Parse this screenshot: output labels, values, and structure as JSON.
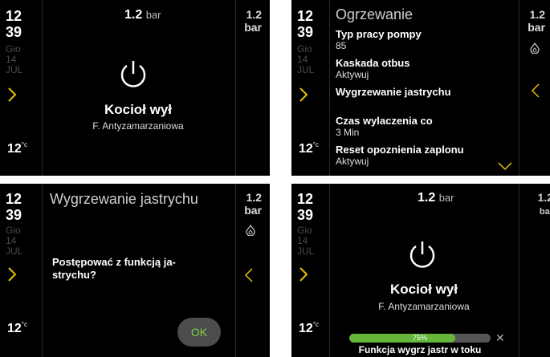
{
  "common": {
    "time_hour": "12",
    "time_minute": "39",
    "day": "Gio",
    "day_num": "14",
    "month": "JUL",
    "outdoor_temp": "12",
    "outdoor_unit": "°c",
    "pressure_value": "1.2",
    "pressure_unit": "bar"
  },
  "screen_home": {
    "status": "Kocioł wył",
    "substatus": "F. Antyzamarzaniowa"
  },
  "screen_menu": {
    "title": "Ogrzewanie",
    "items": [
      {
        "label": "Typ pracy pompy",
        "value": "85"
      },
      {
        "label": "Kaskada otbus",
        "value": "Aktywuj"
      },
      {
        "label": "Wygrzewanie jastrychu",
        "value": ""
      },
      {
        "label": "Czas wylaczenia co",
        "value": "3 Min"
      },
      {
        "label": "Reset opoznienia zaplonu",
        "value": "Aktywuj"
      }
    ]
  },
  "screen_confirm": {
    "title": "Wygrzewanie jastrychu",
    "question_line1": "Postępować z funkcją ja-",
    "question_line2": "strychu?",
    "ok_label": "OK"
  },
  "screen_progress": {
    "status": "Kocioł wył",
    "substatus": "F. Antyzamarzaniowa",
    "progress": 75,
    "progress_label": "75%",
    "progress_text": "Funkcja wygrz jastr w toku"
  },
  "colors": {
    "background": "#000000",
    "accent_green": "#66b63b",
    "ok_text": "#7fd24a"
  }
}
